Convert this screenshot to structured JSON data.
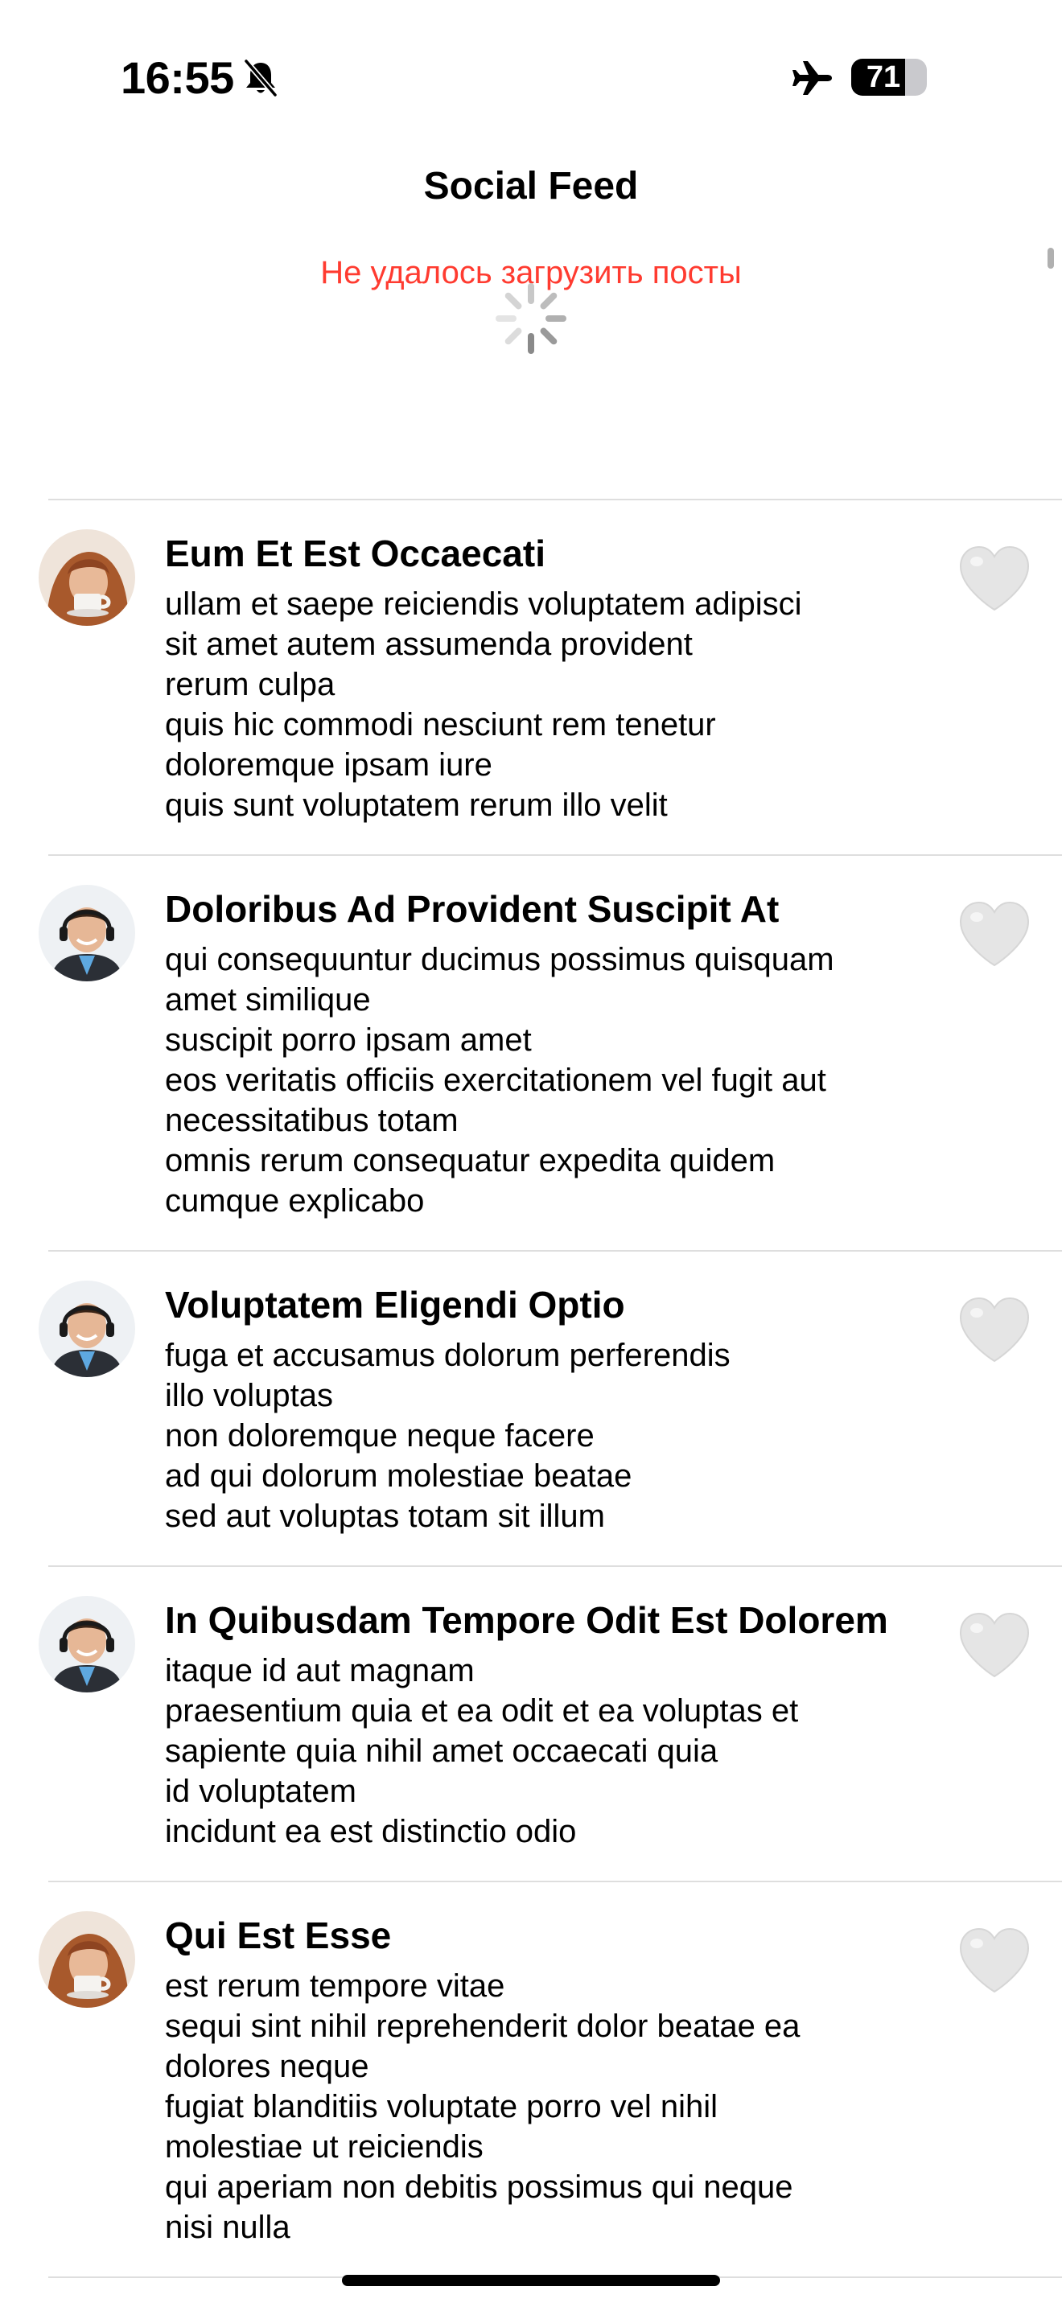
{
  "status_bar": {
    "time": "16:55",
    "battery_level": "71",
    "battery_fraction": 0.71,
    "icons": [
      "bell-slash-icon",
      "airplane-icon",
      "battery-icon"
    ]
  },
  "header": {
    "title": "Social Feed",
    "error_message": "Не удалось загрузить посты",
    "loading_indicator": "spinner-icon"
  },
  "colors": {
    "error": "#ff3b30",
    "heart": "#e5e5e5",
    "separator": "#dedede"
  },
  "posts": [
    {
      "avatar": "woman-with-cup-avatar",
      "title": "Eum Et Est Occaecati",
      "body": "ullam et saepe reiciendis voluptatem adipisci\nsit amet autem assumenda provident\nrerum culpa\nquis hic commodi nesciunt rem tenetur\ndoloremque ipsam iure\nquis sunt voluptatem rerum illo velit",
      "like_icon": "heart-icon"
    },
    {
      "avatar": "man-with-headset-avatar",
      "title": "Doloribus Ad Provident Suscipit At",
      "body": "qui consequuntur ducimus possimus quisquam\namet similique\nsuscipit porro ipsam amet\neos veritatis officiis exercitationem vel fugit aut\nnecessitatibus totam\nomnis rerum consequatur expedita quidem\ncumque explicabo",
      "like_icon": "heart-icon"
    },
    {
      "avatar": "man-with-headset-avatar",
      "title": "Voluptatem Eligendi Optio",
      "body": "fuga et accusamus dolorum perferendis\nillo voluptas\nnon doloremque neque facere\nad qui dolorum molestiae beatae\nsed aut voluptas totam sit illum",
      "like_icon": "heart-icon"
    },
    {
      "avatar": "man-with-headset-avatar",
      "title": "In Quibusdam Tempore Odit Est Dolorem",
      "body": "itaque id aut magnam\npraesentium quia et ea odit et ea voluptas et\nsapiente quia nihil amet occaecati quia\nid voluptatem\nincidunt ea est distinctio odio",
      "like_icon": "heart-icon"
    },
    {
      "avatar": "woman-with-cup-avatar",
      "title": "Qui Est Esse",
      "body": "est rerum tempore vitae\nsequi sint nihil reprehenderit dolor beatae ea\ndolores neque\nfugiat blanditiis voluptate porro vel nihil\nmolestiae ut reiciendis\nqui aperiam non debitis possimus qui neque\nnisi nulla",
      "like_icon": "heart-icon"
    }
  ]
}
